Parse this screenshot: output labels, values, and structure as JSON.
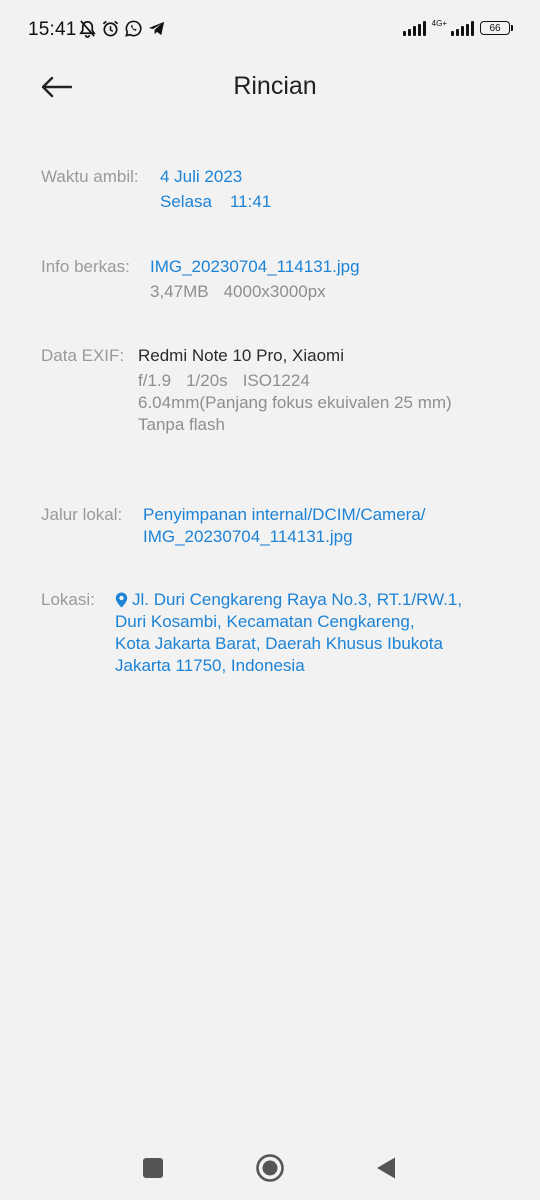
{
  "status_bar": {
    "time": "15:41",
    "network_label": "4G+",
    "battery": "66",
    "icons": [
      "mute-notification-icon",
      "alarm-icon",
      "whatsapp-icon",
      "telegram-icon",
      "signal-icon",
      "battery-icon"
    ]
  },
  "header": {
    "title": "Rincian",
    "back_icon": "arrow-left-icon"
  },
  "details": {
    "waktu": {
      "label": "Waktu ambil:",
      "date": "4 Juli 2023",
      "day": "Selasa",
      "time": "11:41"
    },
    "info": {
      "label": "Info berkas:",
      "filename": "IMG_20230704_114131.jpg",
      "size": "3,47MB",
      "resolution": "4000x3000px"
    },
    "exif": {
      "label": "Data EXIF:",
      "device": "Redmi Note 10 Pro, Xiaomi",
      "aperture": "f/1.9",
      "shutter": "1/20s",
      "iso": "ISO1224",
      "focal": "6.04mm(Panjang fokus ekuivalen 25 mm)",
      "flash": "Tanpa flash"
    },
    "jalur": {
      "label": "Jalur lokal:",
      "line1": "Penyimpanan internal/DCIM/Camera/",
      "line2": "IMG_20230704_114131.jpg"
    },
    "lokasi": {
      "label": "Lokasi:",
      "line1": "Jl. Duri Cengkareng Raya No.3, RT.1/RW.1,",
      "line2": "Duri Kosambi, Kecamatan Cengkareng,",
      "line3": "Kota Jakarta Barat, Daerah Khusus Ibukota",
      "line4": "Jakarta 11750, Indonesia",
      "icon": "location-pin-icon"
    }
  },
  "nav_bar": {
    "icons": [
      "recents-icon",
      "home-icon",
      "back-icon"
    ]
  },
  "colors": {
    "background": "#f2f2f2",
    "accent": "#1d83d6",
    "label": "#9a9a9a",
    "secondary": "#8f8f8f"
  }
}
